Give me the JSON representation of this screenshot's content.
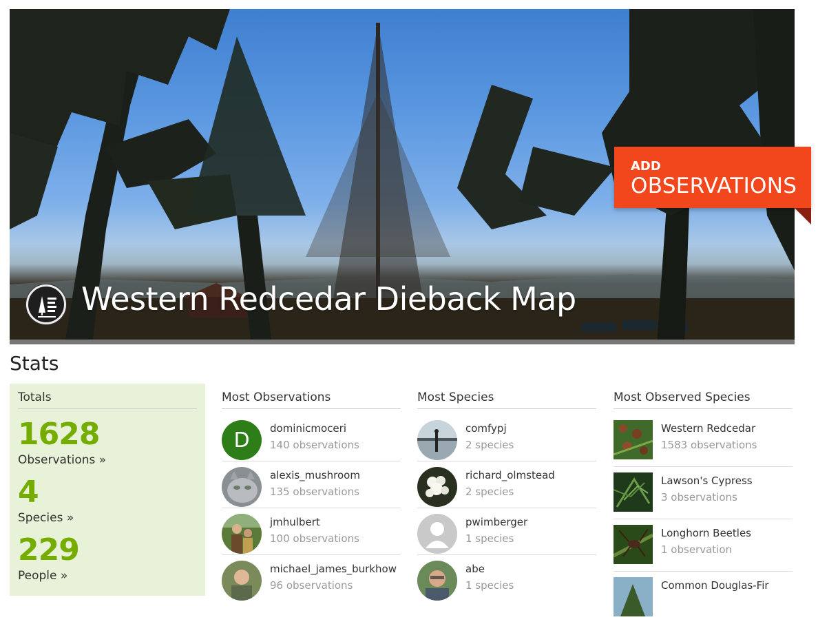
{
  "hero": {
    "title": "Western Redcedar Dieback Map",
    "add_small": "ADD",
    "add_big": "OBSERVATIONS",
    "logo_icon": "forest-health-watch-logo"
  },
  "stats": {
    "heading": "Stats",
    "totals": {
      "title": "Totals",
      "observations_count": "1628",
      "observations_label": "Observations »",
      "species_count": "4",
      "species_label": "Species »",
      "people_count": "229",
      "people_label": "People »"
    },
    "most_observations": {
      "title": "Most Observations",
      "rows": [
        {
          "name": "dominicmoceri",
          "sub": "140 observations"
        },
        {
          "name": "alexis_mushroom",
          "sub": "135 observations"
        },
        {
          "name": "jmhulbert",
          "sub": "100 observations"
        },
        {
          "name": "michael_james_burkhow",
          "sub": "96 observations"
        }
      ]
    },
    "most_species": {
      "title": "Most Species",
      "rows": [
        {
          "name": "comfypj",
          "sub": "2 species"
        },
        {
          "name": "richard_olmstead",
          "sub": "2 species"
        },
        {
          "name": "pwimberger",
          "sub": "1 species"
        },
        {
          "name": "abe",
          "sub": "1 species"
        }
      ]
    },
    "most_observed_species": {
      "title": "Most Observed Species",
      "rows": [
        {
          "name": "Western Redcedar",
          "sub": "1583 observations"
        },
        {
          "name": "Lawson's Cypress",
          "sub": "3 observations"
        },
        {
          "name": "Longhorn Beetles",
          "sub": "1 observation"
        },
        {
          "name": "Common Douglas-Fir",
          "sub": ""
        }
      ]
    }
  },
  "colors": {
    "accent_green": "#74ac00",
    "add_button": "#f2461d",
    "totals_bg": "#e7f2d9"
  }
}
